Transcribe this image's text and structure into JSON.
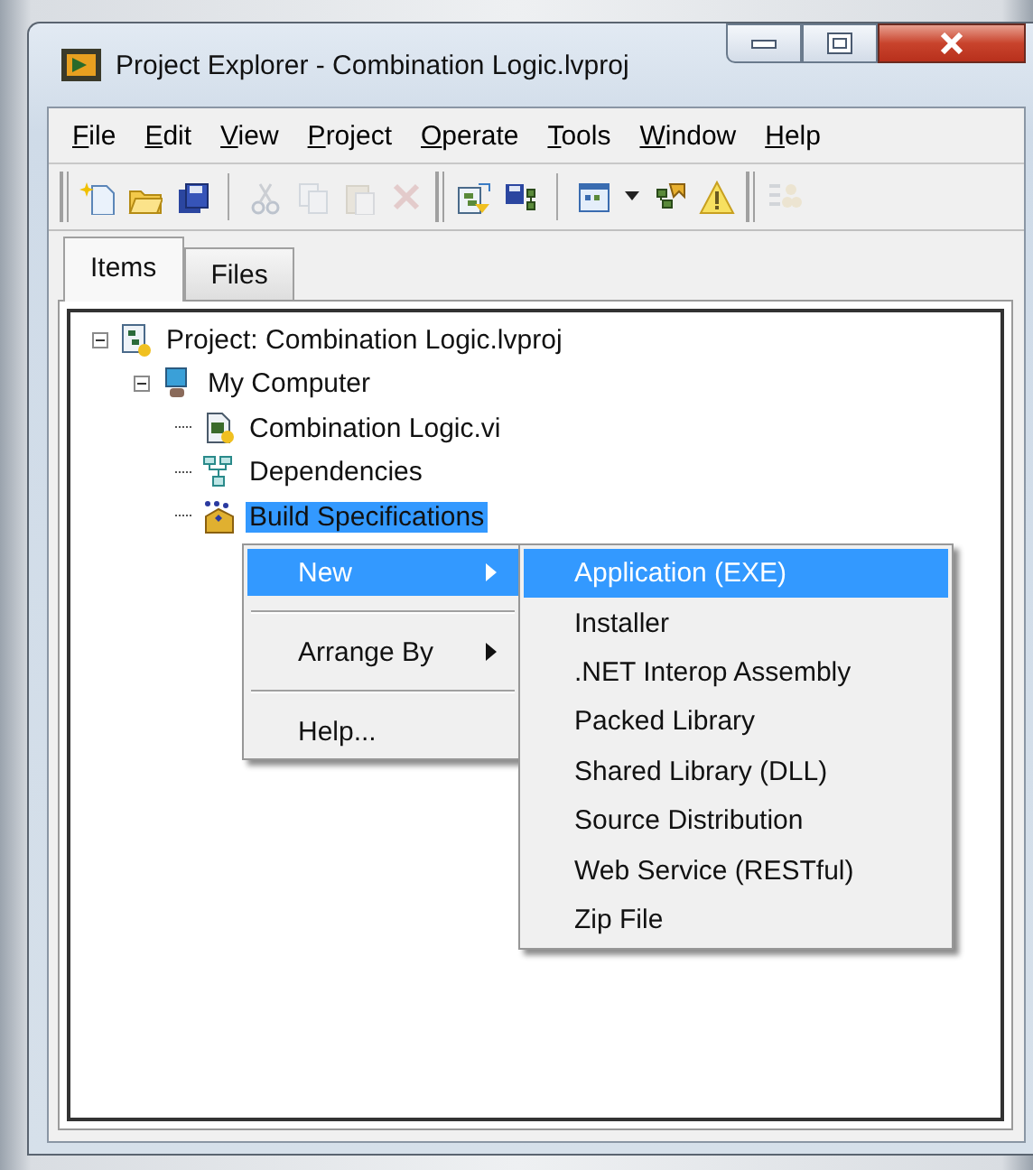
{
  "window": {
    "title": "Project Explorer - Combination Logic.lvproj"
  },
  "menu_bar": [
    "File",
    "Edit",
    "View",
    "Project",
    "Operate",
    "Tools",
    "Window",
    "Help"
  ],
  "toolbar": [
    {
      "kind": "grip"
    },
    {
      "kind": "new",
      "disabled": false
    },
    {
      "kind": "open",
      "disabled": false
    },
    {
      "kind": "save-all",
      "disabled": false
    },
    {
      "kind": "separator"
    },
    {
      "kind": "cut",
      "disabled": true
    },
    {
      "kind": "copy",
      "disabled": true
    },
    {
      "kind": "paste",
      "disabled": true
    },
    {
      "kind": "delete",
      "disabled": true
    },
    {
      "kind": "grip"
    },
    {
      "kind": "build",
      "disabled": false
    },
    {
      "kind": "save-hierarchy",
      "disabled": false
    },
    {
      "kind": "separator"
    },
    {
      "kind": "view",
      "disabled": false
    },
    {
      "kind": "dropdown",
      "disabled": false
    },
    {
      "kind": "resolve",
      "disabled": false
    },
    {
      "kind": "warning",
      "disabled": false
    },
    {
      "kind": "grip"
    },
    {
      "kind": "stack",
      "disabled": true
    }
  ],
  "tabs": [
    {
      "label": "Items",
      "selected": true
    },
    {
      "label": "Files",
      "selected": false
    }
  ],
  "tree": [
    {
      "label": "Project: Combination Logic.lvproj",
      "kind": "project",
      "expanded": true,
      "selected": false,
      "children": [
        {
          "label": "My Computer",
          "kind": "computer",
          "expanded": true,
          "selected": false,
          "children": [
            {
              "label": "Combination Logic.vi",
              "kind": "vi",
              "selected": false
            },
            {
              "label": "Dependencies",
              "kind": "dependencies",
              "selected": false
            },
            {
              "label": "Build Specifications",
              "kind": "build",
              "selected": true
            }
          ]
        }
      ]
    }
  ],
  "context_menu": [
    {
      "kind": "item",
      "label": "New",
      "submenu": true,
      "selected": true
    },
    {
      "kind": "separator"
    },
    {
      "kind": "item",
      "label": "Arrange By",
      "submenu": true,
      "selected": false
    },
    {
      "kind": "separator"
    },
    {
      "kind": "item",
      "label": "Help...",
      "submenu": false,
      "selected": false
    }
  ],
  "submenu": [
    {
      "label": "Application (EXE)",
      "selected": true
    },
    {
      "label": "Installer",
      "selected": false
    },
    {
      "label": ".NET Interop Assembly",
      "selected": false
    },
    {
      "label": "Packed Library",
      "selected": false
    },
    {
      "label": "Shared Library (DLL)",
      "selected": false
    },
    {
      "label": "Source Distribution",
      "selected": false
    },
    {
      "label": "Web Service (RESTful)",
      "selected": false
    },
    {
      "label": "Zip File",
      "selected": false
    }
  ]
}
